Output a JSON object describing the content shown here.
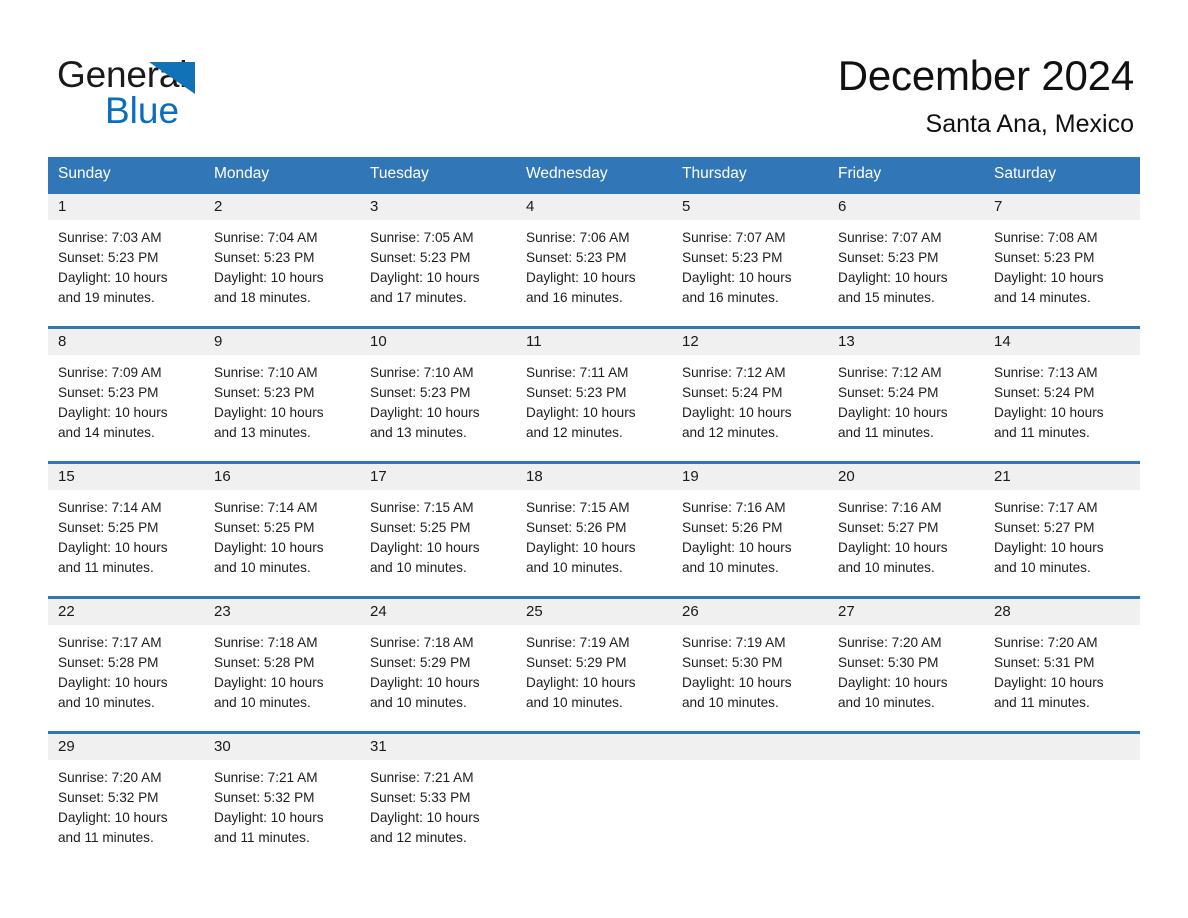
{
  "brand": {
    "name_part1": "General",
    "name_part2": "Blue",
    "triangle_color": "#1272b8",
    "blue_color": "#0a6ebd"
  },
  "header": {
    "month_title": "December 2024",
    "location": "Santa Ana, Mexico"
  },
  "theme": {
    "header_blue": "#3177b8",
    "row_rule_blue": "#3177b8",
    "daynum_band": "#f0f0f0",
    "text": "#1d1d1d"
  },
  "weekdays": [
    "Sunday",
    "Monday",
    "Tuesday",
    "Wednesday",
    "Thursday",
    "Friday",
    "Saturday"
  ],
  "weeks": [
    [
      {
        "day": "1",
        "sunrise": "Sunrise: 7:03 AM",
        "sunset": "Sunset: 5:23 PM",
        "daylight1": "Daylight: 10 hours",
        "daylight2": "and 19 minutes."
      },
      {
        "day": "2",
        "sunrise": "Sunrise: 7:04 AM",
        "sunset": "Sunset: 5:23 PM",
        "daylight1": "Daylight: 10 hours",
        "daylight2": "and 18 minutes."
      },
      {
        "day": "3",
        "sunrise": "Sunrise: 7:05 AM",
        "sunset": "Sunset: 5:23 PM",
        "daylight1": "Daylight: 10 hours",
        "daylight2": "and 17 minutes."
      },
      {
        "day": "4",
        "sunrise": "Sunrise: 7:06 AM",
        "sunset": "Sunset: 5:23 PM",
        "daylight1": "Daylight: 10 hours",
        "daylight2": "and 16 minutes."
      },
      {
        "day": "5",
        "sunrise": "Sunrise: 7:07 AM",
        "sunset": "Sunset: 5:23 PM",
        "daylight1": "Daylight: 10 hours",
        "daylight2": "and 16 minutes."
      },
      {
        "day": "6",
        "sunrise": "Sunrise: 7:07 AM",
        "sunset": "Sunset: 5:23 PM",
        "daylight1": "Daylight: 10 hours",
        "daylight2": "and 15 minutes."
      },
      {
        "day": "7",
        "sunrise": "Sunrise: 7:08 AM",
        "sunset": "Sunset: 5:23 PM",
        "daylight1": "Daylight: 10 hours",
        "daylight2": "and 14 minutes."
      }
    ],
    [
      {
        "day": "8",
        "sunrise": "Sunrise: 7:09 AM",
        "sunset": "Sunset: 5:23 PM",
        "daylight1": "Daylight: 10 hours",
        "daylight2": "and 14 minutes."
      },
      {
        "day": "9",
        "sunrise": "Sunrise: 7:10 AM",
        "sunset": "Sunset: 5:23 PM",
        "daylight1": "Daylight: 10 hours",
        "daylight2": "and 13 minutes."
      },
      {
        "day": "10",
        "sunrise": "Sunrise: 7:10 AM",
        "sunset": "Sunset: 5:23 PM",
        "daylight1": "Daylight: 10 hours",
        "daylight2": "and 13 minutes."
      },
      {
        "day": "11",
        "sunrise": "Sunrise: 7:11 AM",
        "sunset": "Sunset: 5:23 PM",
        "daylight1": "Daylight: 10 hours",
        "daylight2": "and 12 minutes."
      },
      {
        "day": "12",
        "sunrise": "Sunrise: 7:12 AM",
        "sunset": "Sunset: 5:24 PM",
        "daylight1": "Daylight: 10 hours",
        "daylight2": "and 12 minutes."
      },
      {
        "day": "13",
        "sunrise": "Sunrise: 7:12 AM",
        "sunset": "Sunset: 5:24 PM",
        "daylight1": "Daylight: 10 hours",
        "daylight2": "and 11 minutes."
      },
      {
        "day": "14",
        "sunrise": "Sunrise: 7:13 AM",
        "sunset": "Sunset: 5:24 PM",
        "daylight1": "Daylight: 10 hours",
        "daylight2": "and 11 minutes."
      }
    ],
    [
      {
        "day": "15",
        "sunrise": "Sunrise: 7:14 AM",
        "sunset": "Sunset: 5:25 PM",
        "daylight1": "Daylight: 10 hours",
        "daylight2": "and 11 minutes."
      },
      {
        "day": "16",
        "sunrise": "Sunrise: 7:14 AM",
        "sunset": "Sunset: 5:25 PM",
        "daylight1": "Daylight: 10 hours",
        "daylight2": "and 10 minutes."
      },
      {
        "day": "17",
        "sunrise": "Sunrise: 7:15 AM",
        "sunset": "Sunset: 5:25 PM",
        "daylight1": "Daylight: 10 hours",
        "daylight2": "and 10 minutes."
      },
      {
        "day": "18",
        "sunrise": "Sunrise: 7:15 AM",
        "sunset": "Sunset: 5:26 PM",
        "daylight1": "Daylight: 10 hours",
        "daylight2": "and 10 minutes."
      },
      {
        "day": "19",
        "sunrise": "Sunrise: 7:16 AM",
        "sunset": "Sunset: 5:26 PM",
        "daylight1": "Daylight: 10 hours",
        "daylight2": "and 10 minutes."
      },
      {
        "day": "20",
        "sunrise": "Sunrise: 7:16 AM",
        "sunset": "Sunset: 5:27 PM",
        "daylight1": "Daylight: 10 hours",
        "daylight2": "and 10 minutes."
      },
      {
        "day": "21",
        "sunrise": "Sunrise: 7:17 AM",
        "sunset": "Sunset: 5:27 PM",
        "daylight1": "Daylight: 10 hours",
        "daylight2": "and 10 minutes."
      }
    ],
    [
      {
        "day": "22",
        "sunrise": "Sunrise: 7:17 AM",
        "sunset": "Sunset: 5:28 PM",
        "daylight1": "Daylight: 10 hours",
        "daylight2": "and 10 minutes."
      },
      {
        "day": "23",
        "sunrise": "Sunrise: 7:18 AM",
        "sunset": "Sunset: 5:28 PM",
        "daylight1": "Daylight: 10 hours",
        "daylight2": "and 10 minutes."
      },
      {
        "day": "24",
        "sunrise": "Sunrise: 7:18 AM",
        "sunset": "Sunset: 5:29 PM",
        "daylight1": "Daylight: 10 hours",
        "daylight2": "and 10 minutes."
      },
      {
        "day": "25",
        "sunrise": "Sunrise: 7:19 AM",
        "sunset": "Sunset: 5:29 PM",
        "daylight1": "Daylight: 10 hours",
        "daylight2": "and 10 minutes."
      },
      {
        "day": "26",
        "sunrise": "Sunrise: 7:19 AM",
        "sunset": "Sunset: 5:30 PM",
        "daylight1": "Daylight: 10 hours",
        "daylight2": "and 10 minutes."
      },
      {
        "day": "27",
        "sunrise": "Sunrise: 7:20 AM",
        "sunset": "Sunset: 5:30 PM",
        "daylight1": "Daylight: 10 hours",
        "daylight2": "and 10 minutes."
      },
      {
        "day": "28",
        "sunrise": "Sunrise: 7:20 AM",
        "sunset": "Sunset: 5:31 PM",
        "daylight1": "Daylight: 10 hours",
        "daylight2": "and 11 minutes."
      }
    ],
    [
      {
        "day": "29",
        "sunrise": "Sunrise: 7:20 AM",
        "sunset": "Sunset: 5:32 PM",
        "daylight1": "Daylight: 10 hours",
        "daylight2": "and 11 minutes."
      },
      {
        "day": "30",
        "sunrise": "Sunrise: 7:21 AM",
        "sunset": "Sunset: 5:32 PM",
        "daylight1": "Daylight: 10 hours",
        "daylight2": "and 11 minutes."
      },
      {
        "day": "31",
        "sunrise": "Sunrise: 7:21 AM",
        "sunset": "Sunset: 5:33 PM",
        "daylight1": "Daylight: 10 hours",
        "daylight2": "and 12 minutes."
      },
      {
        "day": "",
        "sunrise": "",
        "sunset": "",
        "daylight1": "",
        "daylight2": ""
      },
      {
        "day": "",
        "sunrise": "",
        "sunset": "",
        "daylight1": "",
        "daylight2": ""
      },
      {
        "day": "",
        "sunrise": "",
        "sunset": "",
        "daylight1": "",
        "daylight2": ""
      },
      {
        "day": "",
        "sunrise": "",
        "sunset": "",
        "daylight1": "",
        "daylight2": ""
      }
    ]
  ]
}
